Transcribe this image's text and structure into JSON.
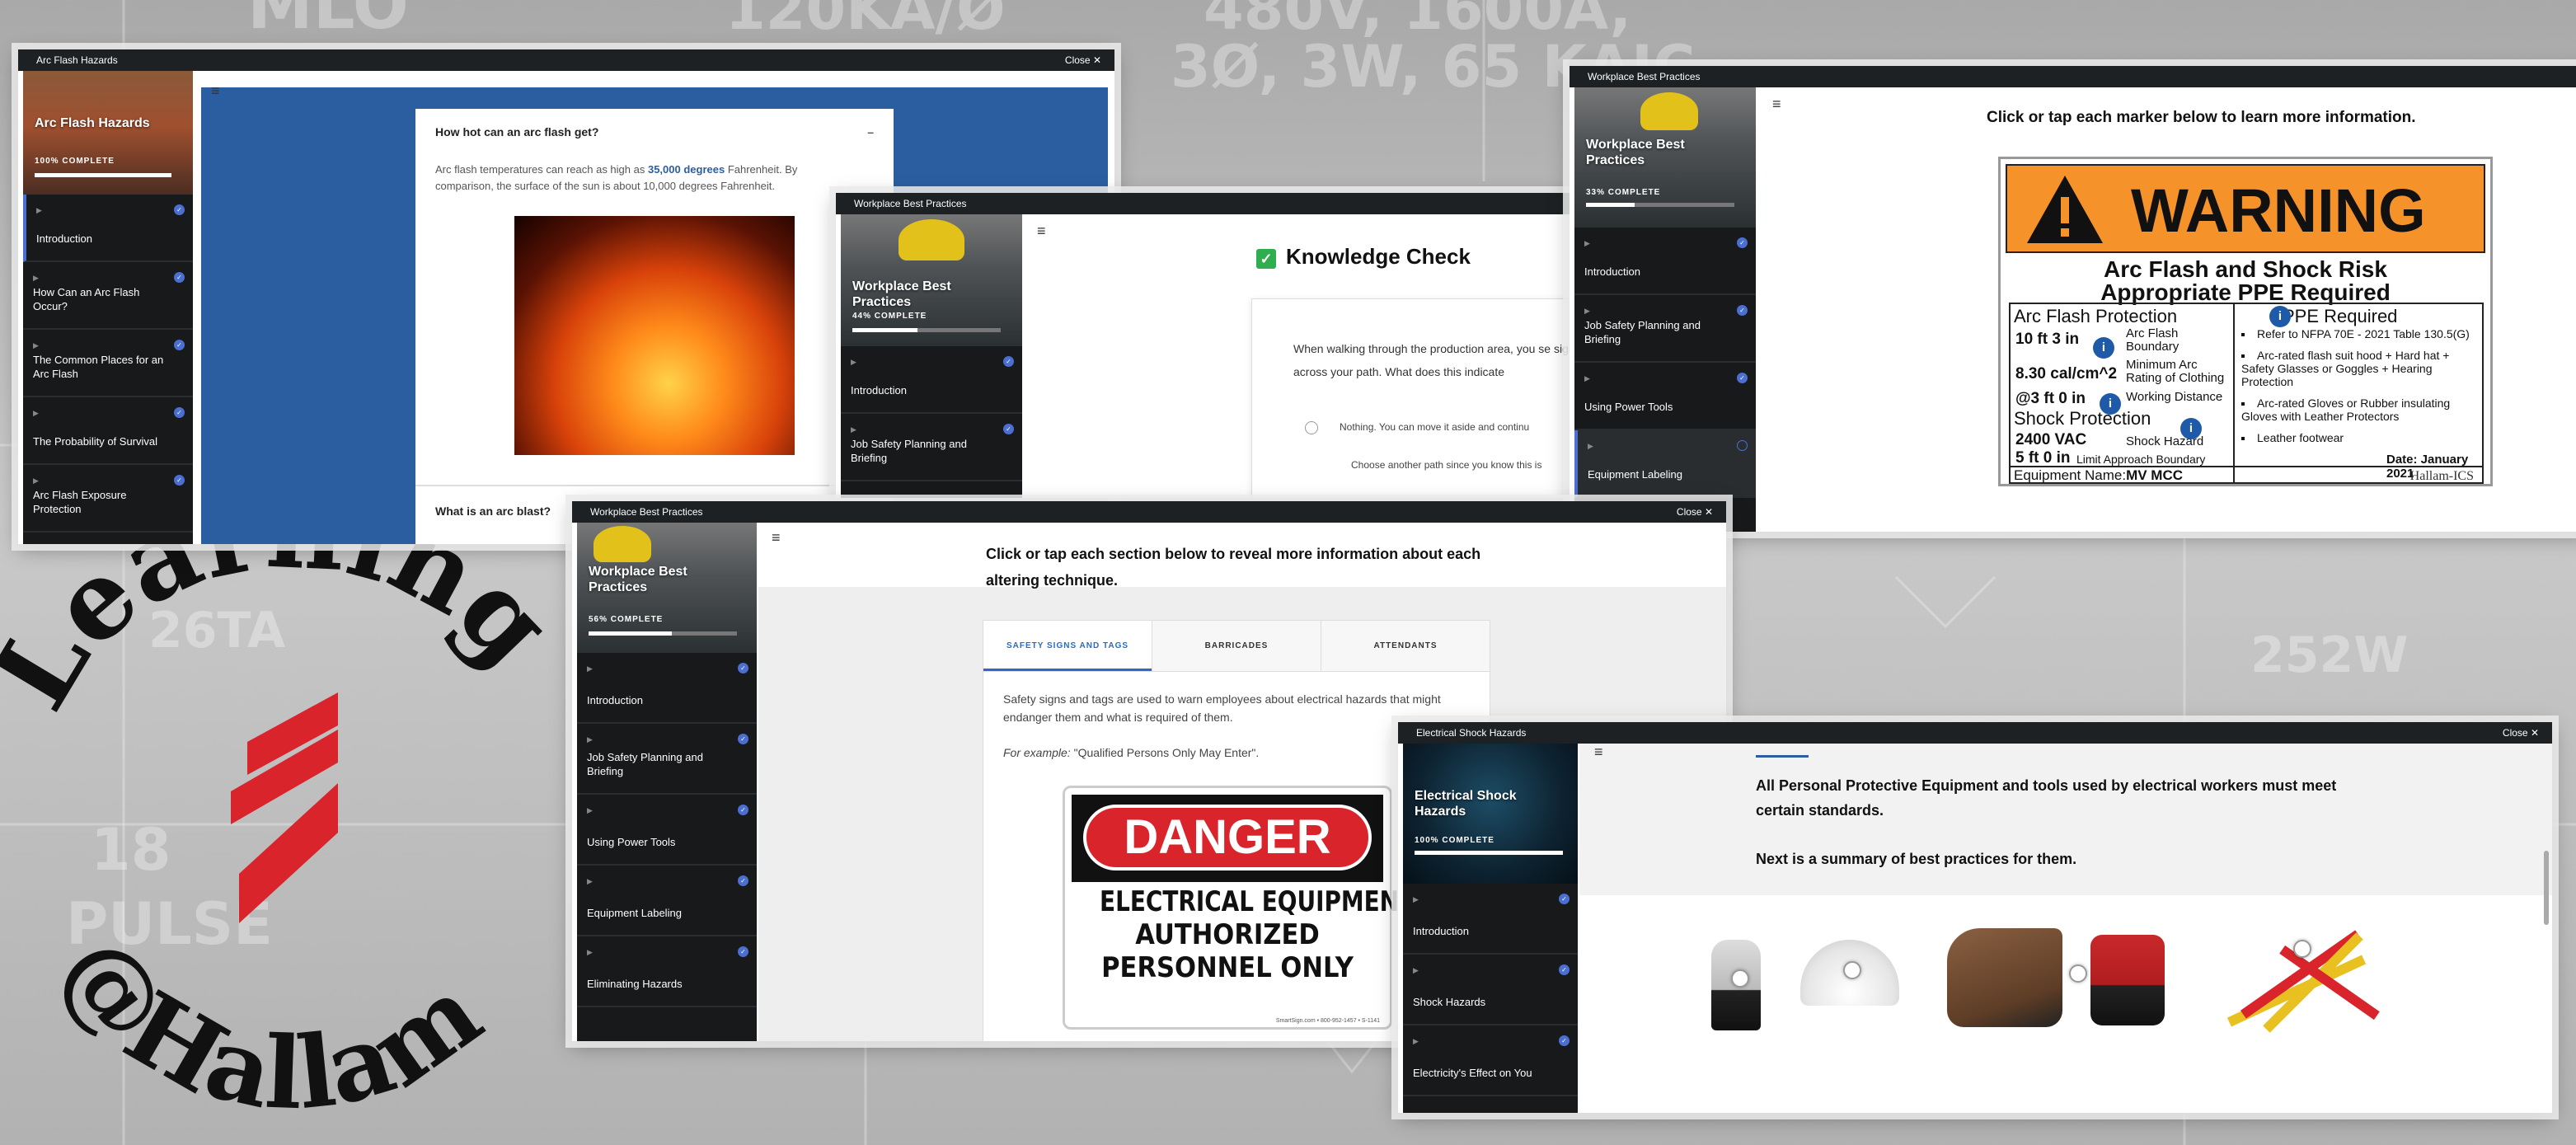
{
  "background": {
    "numbers": [
      "MLO",
      "120KA/Ø",
      "480V, 1600A,",
      "3Ø, 3W, 65 KAIC",
      "26TA",
      "18",
      "PULSE",
      "252W"
    ],
    "logo_line1": "Learning",
    "logo_line2": "@Hallam",
    "logo_color": "#d9242b"
  },
  "win1": {
    "title": "Arc Flash Hazards",
    "close": "Close",
    "course": "Arc Flash Hazards",
    "progress": "100% COMPLETE",
    "progress_pct": 100,
    "menu": [
      "Introduction",
      "How Can an Arc Flash Occur?",
      "The Common Places for an Arc Flash",
      "The Probability of Survival",
      "Arc Flash Exposure Protection"
    ],
    "accordion": {
      "q1": "How hot can an arc flash get?",
      "collapse": "–",
      "body_pre": "Arc flash temperatures can reach as high as ",
      "body_highlight": "35,000 degrees",
      "body_post": " Fahrenheit. By comparison, the surface of the sun is about 10,000 degrees Fahrenheit.",
      "q2": "What is an arc blast?"
    }
  },
  "win2": {
    "title": "Workplace Best Practices",
    "course": "Workplace Best Practices",
    "progress": "44% COMPLETE",
    "progress_pct": 44,
    "menu": [
      "Introduction",
      "Job Safety Planning and Briefing"
    ],
    "heading": "Knowledge Check",
    "question": "When walking through the production area, you se signage across your path.  What does this indicate",
    "option1": "Nothing.  You can move it aside and continu",
    "option2": "Choose another path since you know this is"
  },
  "win3": {
    "title": "Workplace Best Practices",
    "course": "Workplace Best Practices",
    "progress": "33% COMPLETE",
    "progress_pct": 33,
    "menu": [
      "Introduction",
      "Job Safety Planning and Briefing",
      "Using Power Tools",
      "Equipment Labeling"
    ],
    "instruction": "Click or tap each marker below to learn more information.",
    "label": {
      "warning": "WARNING",
      "title1": "Arc Flash and Shock Risk",
      "title2": "Appropriate PPE Required",
      "arc_hdr": "Arc Flash Protection",
      "rows": [
        {
          "v": "10 ft 3 in",
          "d": "Arc Flash Boundary"
        },
        {
          "v": "8.30 cal/cm^2",
          "d": "Minimum Arc Rating of Clothing"
        },
        {
          "v": "@3 ft 0 in",
          "d": "Working Distance"
        }
      ],
      "shock_hdr": "Shock Protection",
      "shock_rows": [
        {
          "v": "2400 VAC",
          "d": "Shock Hazard"
        },
        {
          "v": "5 ft 0 in",
          "d": "Limit Approach Boundary"
        }
      ],
      "ppe_hdr": "PPE Required",
      "ppe": [
        "Refer to NFPA 70E - 2021 Table 130.5(G)",
        "Arc-rated flash suit hood + Hard hat + Safety Glasses or Goggles + Hearing Protection",
        "Arc-rated Gloves or Rubber insulating Gloves with Leather Protectors",
        "Leather footwear"
      ],
      "date": "Date: January 2021",
      "equip_lbl": "Equipment Name:",
      "equip": "MV MCC",
      "brand": "Hallam-ICS"
    }
  },
  "win4": {
    "title": "Workplace Best Practices",
    "close": "Close",
    "course": "Workplace Best Practices",
    "progress": "56% COMPLETE",
    "progress_pct": 56,
    "menu": [
      "Introduction",
      "Job Safety Planning and Briefing",
      "Using Power Tools",
      "Equipment Labeling",
      "Eliminating Hazards"
    ],
    "heading": "Click or tap each section below to reveal more information about each altering technique.",
    "tabs": [
      "SAFETY SIGNS AND TAGS",
      "BARRICADES",
      "ATTENDANTS"
    ],
    "tab_text": "Safety signs and tags are used to warn employees about electrical hazards that might endanger them and what is required of them.",
    "example_lbl": "For example:",
    "example": " \"Qualified Persons Only May Enter\".",
    "sign": {
      "danger": "DANGER",
      "l1": "ELECTRICAL EQUIPMENT",
      "l2": "AUTHORIZED",
      "l3": "PERSONNEL ONLY",
      "small": "SmartSign.com • 800-952-1457 • S-1141"
    }
  },
  "win5": {
    "title": "Electrical Shock Hazards",
    "close": "Close",
    "course": "Electrical Shock Hazards",
    "progress": "100% COMPLETE",
    "progress_pct": 100,
    "menu": [
      "Introduction",
      "Shock Hazards",
      "Electricity's Effect on You"
    ],
    "p1": "All Personal Protective Equipment and tools used by electrical workers must meet certain standards.",
    "p2": "Next is a summary of best practices for them."
  }
}
